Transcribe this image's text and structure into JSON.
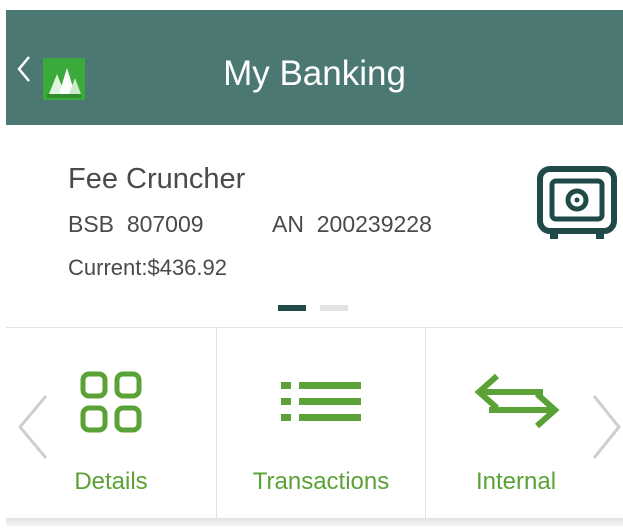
{
  "header": {
    "title": "My Banking",
    "back_icon": "chevron-left-icon",
    "logo_icon": "bank-logo-icon",
    "background": "#4c7873"
  },
  "account": {
    "name": "Fee Cruncher",
    "bsb_label": "BSB",
    "bsb_value": "807009",
    "an_label": "AN",
    "an_value": "200239228",
    "current": "Current:$436.92",
    "icon": "safe-icon",
    "pager": {
      "count": 2,
      "active": 0
    }
  },
  "actions": [
    {
      "label": "Details",
      "icon": "grid-icon"
    },
    {
      "label": "Transactions",
      "icon": "list-icon"
    },
    {
      "label": "Internal",
      "icon": "transfer-arrows-icon"
    }
  ],
  "colors": {
    "accent_green": "#5aa235",
    "dark_teal": "#1f4a47",
    "text": "#4a4a4a"
  }
}
